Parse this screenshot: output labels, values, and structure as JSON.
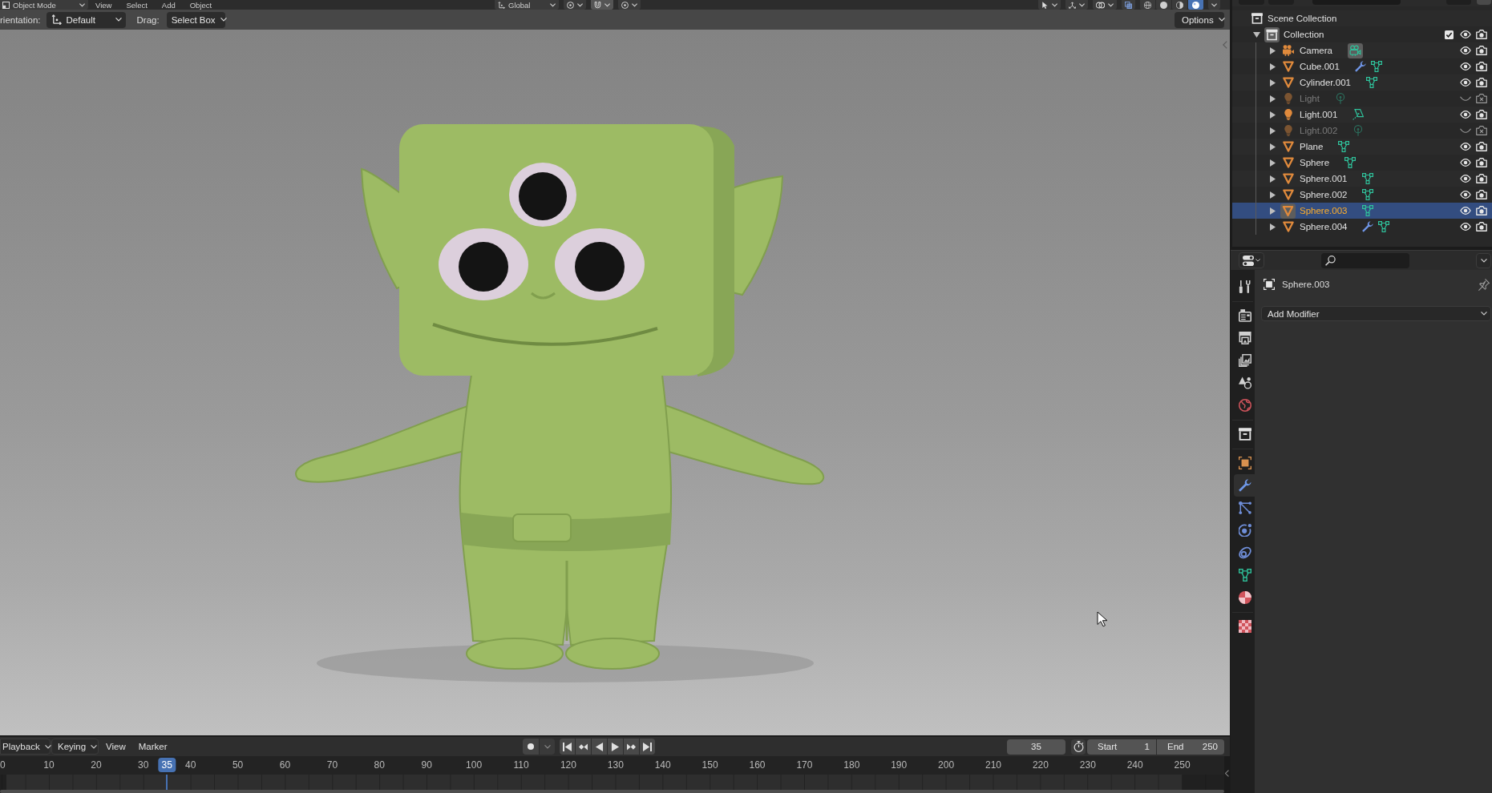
{
  "viewport_header": {
    "mode": "Object Mode",
    "menus": [
      "View",
      "Select",
      "Add",
      "Object"
    ],
    "orientation": "Global",
    "shading": [
      {
        "kind": "wireframe",
        "selected": false
      },
      {
        "kind": "solid",
        "selected": false
      },
      {
        "kind": "material",
        "selected": false
      },
      {
        "kind": "rendered",
        "selected": true
      }
    ]
  },
  "tool_settings": {
    "orientation_label": "rientation:",
    "orientation": "Default",
    "drag_label": "Drag:",
    "drag": "Select Box",
    "options": "Options"
  },
  "outliner": {
    "tree": [
      {
        "label": "Scene Collection",
        "kind": "scene_collection",
        "children": [
          {
            "label": "Collection",
            "kind": "collection",
            "expanded": true,
            "selected": false,
            "active": true,
            "checked": true,
            "visible": true,
            "renderable": true,
            "children": [
              {
                "label": "Camera",
                "kind": "camera",
                "expanded": false,
                "selected": false,
                "active": false,
                "visible": true,
                "renderable": true,
                "data": [
                  {
                    "kind": "camera",
                    "active": true
                  }
                ]
              },
              {
                "label": "Cube.001",
                "kind": "mesh",
                "expanded": false,
                "selected": false,
                "active": false,
                "visible": true,
                "renderable": true,
                "data": [
                  {
                    "kind": "modifier",
                    "active": false
                  },
                  {
                    "kind": "mesh",
                    "active": false
                  }
                ]
              },
              {
                "label": "Cylinder.001",
                "kind": "mesh",
                "expanded": false,
                "selected": false,
                "active": false,
                "visible": true,
                "renderable": true,
                "data": [
                  {
                    "kind": "mesh",
                    "active": false
                  }
                ]
              },
              {
                "label": "Light",
                "kind": "light",
                "expanded": false,
                "selected": false,
                "active": false,
                "visible": false,
                "renderable": false,
                "data": [
                  {
                    "kind": "point_light",
                    "active": false
                  }
                ]
              },
              {
                "label": "Light.001",
                "kind": "light",
                "expanded": false,
                "selected": false,
                "active": false,
                "visible": true,
                "renderable": true,
                "data": [
                  {
                    "kind": "area_light",
                    "active": false
                  }
                ]
              },
              {
                "label": "Light.002",
                "kind": "light",
                "expanded": false,
                "selected": false,
                "active": false,
                "visible": false,
                "renderable": false,
                "data": [
                  {
                    "kind": "point_light",
                    "active": false
                  }
                ]
              },
              {
                "label": "Plane",
                "kind": "mesh",
                "expanded": false,
                "selected": false,
                "active": false,
                "visible": true,
                "renderable": true,
                "data": [
                  {
                    "kind": "mesh",
                    "active": false
                  }
                ]
              },
              {
                "label": "Sphere",
                "kind": "mesh",
                "expanded": false,
                "selected": false,
                "active": false,
                "visible": true,
                "renderable": true,
                "data": [
                  {
                    "kind": "mesh",
                    "active": false
                  }
                ]
              },
              {
                "label": "Sphere.001",
                "kind": "mesh",
                "expanded": false,
                "selected": false,
                "active": false,
                "visible": true,
                "renderable": true,
                "data": [
                  {
                    "kind": "mesh",
                    "active": false
                  }
                ]
              },
              {
                "label": "Sphere.002",
                "kind": "mesh",
                "expanded": false,
                "selected": false,
                "active": false,
                "visible": true,
                "renderable": true,
                "data": [
                  {
                    "kind": "mesh",
                    "active": false
                  }
                ]
              },
              {
                "label": "Sphere.003",
                "kind": "mesh",
                "expanded": false,
                "selected": true,
                "active": true,
                "visible": true,
                "renderable": true,
                "data": [
                  {
                    "kind": "mesh",
                    "active": false
                  }
                ]
              },
              {
                "label": "Sphere.004",
                "kind": "mesh",
                "expanded": false,
                "selected": false,
                "active": false,
                "visible": true,
                "renderable": true,
                "data": [
                  {
                    "kind": "modifier",
                    "active": false
                  },
                  {
                    "kind": "mesh",
                    "active": false
                  }
                ]
              }
            ]
          }
        ]
      }
    ]
  },
  "properties": {
    "tab_groups": [
      [
        {
          "kind": "tool",
          "selected": false
        }
      ],
      [
        {
          "kind": "render",
          "selected": false
        },
        {
          "kind": "output",
          "selected": false
        },
        {
          "kind": "view_layer",
          "selected": false
        },
        {
          "kind": "scene",
          "selected": false
        },
        {
          "kind": "world",
          "selected": false
        }
      ],
      [
        {
          "kind": "collection",
          "selected": false
        }
      ],
      [
        {
          "kind": "object",
          "selected": false
        },
        {
          "kind": "modifiers",
          "selected": true
        },
        {
          "kind": "particles",
          "selected": false
        },
        {
          "kind": "physics",
          "selected": false
        },
        {
          "kind": "constraints",
          "selected": false
        },
        {
          "kind": "data",
          "selected": false
        },
        {
          "kind": "material",
          "selected": false
        }
      ],
      [
        {
          "kind": "texture",
          "selected": false
        }
      ]
    ],
    "object_name": "Sphere.003",
    "add_modifier": "Add Modifier"
  },
  "timeline": {
    "menus": [
      {
        "label": "Playback",
        "kind": "dropdown"
      },
      {
        "label": "Keying",
        "kind": "dropdown"
      },
      {
        "label": "View",
        "kind": "menu"
      },
      {
        "label": "Marker",
        "kind": "menu"
      }
    ],
    "current_frame": "35",
    "start_label": "Start",
    "start": "1",
    "end_label": "End",
    "end": "250",
    "ruler": [
      "0",
      "10",
      "20",
      "30",
      "40",
      "50",
      "60",
      "70",
      "80",
      "90",
      "100",
      "110",
      "120",
      "130",
      "140",
      "150",
      "160",
      "170",
      "180",
      "190",
      "200",
      "210",
      "220",
      "230",
      "240",
      "250"
    ],
    "playhead": {
      "label": "35",
      "level": 0.1365
    }
  }
}
